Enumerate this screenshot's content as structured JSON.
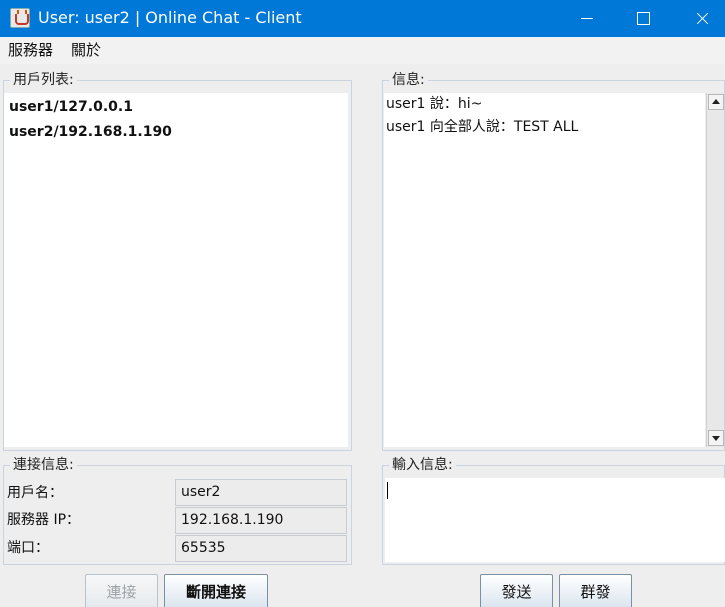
{
  "window": {
    "title": "User: user2 | Online Chat - Client",
    "icon": "java-cup-icon"
  },
  "menu": {
    "items": [
      "服務器",
      "關於"
    ]
  },
  "users_panel": {
    "title": "用戶列表:",
    "users": [
      "user1/127.0.0.1",
      "user2/192.168.1.190"
    ]
  },
  "messages_panel": {
    "title": "信息:",
    "messages": [
      "user1 說：hi~",
      "user1 向全部人說：TEST ALL"
    ]
  },
  "connection_panel": {
    "title": "連接信息:",
    "fields": [
      {
        "label": "用戶名：",
        "value": "user2"
      },
      {
        "label": "服務器 IP：",
        "value": "192.168.1.190"
      },
      {
        "label": "端口：",
        "value": "65535"
      }
    ]
  },
  "input_panel": {
    "title": "輸入信息:",
    "value": ""
  },
  "buttons": {
    "connect": "連接",
    "disconnect": "斷開連接",
    "send": "發送",
    "group_send": "群發"
  },
  "colors": {
    "titlebar": "#0078d7",
    "window_bg": "#eeeeee",
    "group_border": "#c9d4e0",
    "button_border": "#7a8fa8"
  }
}
